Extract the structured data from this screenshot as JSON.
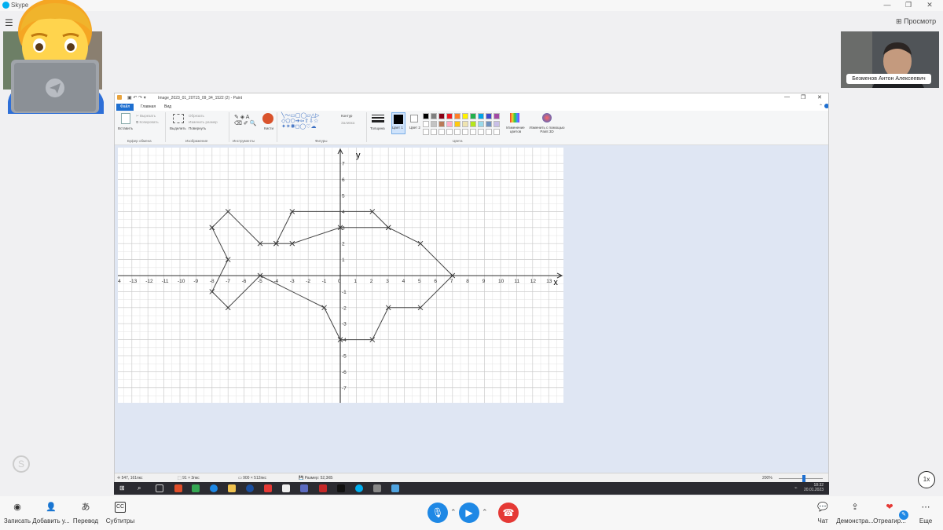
{
  "skype": {
    "app_title": "Skype",
    "preview_label": "Просмотр",
    "remote_participant_name": "Безменов Антон Алексеевич",
    "speed_label": "1x",
    "bottom_left": [
      {
        "label": "Записать",
        "icon": "record-icon"
      },
      {
        "label": "Добавить у...",
        "icon": "add-person-icon"
      },
      {
        "label": "Перевод",
        "icon": "translate-icon"
      },
      {
        "label": "Субтитры",
        "icon": "subtitles-icon"
      }
    ],
    "bottom_right": [
      {
        "label": "Чат",
        "icon": "chat-icon"
      },
      {
        "label": "Демонстра...",
        "icon": "share-screen-icon"
      },
      {
        "label": "Отреагир...",
        "icon": "react-heart-icon"
      },
      {
        "label": "Еще",
        "icon": "more-icon"
      }
    ],
    "colors": {
      "accent": "#1e88e5",
      "hangup": "#e53935"
    }
  },
  "paint": {
    "title": "Image_2023_01_20T15_09_34_1522 (2) - Paint",
    "tabs": [
      "Файл",
      "Главная",
      "Вид"
    ],
    "ribbon": {
      "paste": "Вставить",
      "cut": "Вырезать",
      "copy": "Копировать",
      "clipboard_group": "Буфер обмена",
      "select": "Выделить",
      "crop": "Обрезать",
      "resize": "Изменить размер",
      "rotate": "Повернуть",
      "image_group": "Изображение",
      "tools_group": "Инструменты",
      "brushes": "Кисти",
      "shapes_group": "Фигуры",
      "outline": "Контур",
      "fill": "Заливка",
      "thickness": "Толщина",
      "color1": "Цвет 1",
      "color2": "Цвет 2",
      "colors_group": "Цвета",
      "edit_colors": "Изменение цветов",
      "paint3d": "Изменить с помощью Paint 3D"
    },
    "palette": [
      "#000000",
      "#7f7f7f",
      "#880015",
      "#ed1c24",
      "#ff7f27",
      "#fff200",
      "#22b14c",
      "#00a2e8",
      "#3f48cc",
      "#a349a4",
      "#ffffff",
      "#c3c3c3",
      "#b97a57",
      "#ffaec9",
      "#ffc90e",
      "#efe4b0",
      "#b5e61d",
      "#99d9ea",
      "#7092be",
      "#c8bfe7"
    ],
    "status": {
      "cursor": "547, 161пкс",
      "selection": "91 × 3пкс",
      "canvas_size": "900 × 512пкс",
      "file_size": "Размер: 52,3КБ",
      "zoom": "200%"
    }
  },
  "taskbar": {
    "time": "18:32",
    "date": "20.01.2023"
  },
  "chart_data": {
    "type": "scatter",
    "xlabel": "x",
    "ylabel": "y",
    "xlim": [
      -14,
      13
    ],
    "ylim": [
      -7,
      7
    ],
    "x_ticks": [
      -14,
      -13,
      -12,
      -11,
      -10,
      -9,
      -8,
      -7,
      -6,
      -5,
      -4,
      -3,
      -2,
      -1,
      0,
      1,
      2,
      3,
      4,
      5,
      6,
      7,
      8,
      9,
      10,
      11,
      12,
      13
    ],
    "y_ticks": [
      -7,
      -6,
      -5,
      -4,
      -3,
      -2,
      -1,
      1,
      2,
      3,
      4,
      5,
      6,
      7
    ],
    "grid": true,
    "polylines": [
      {
        "points": [
          [
            -8,
            3
          ],
          [
            -7,
            4
          ],
          [
            -5,
            2
          ],
          [
            -4,
            2
          ],
          [
            -3,
            4
          ],
          [
            2,
            4
          ],
          [
            3,
            3
          ],
          [
            5,
            2
          ],
          [
            7,
            0
          ],
          [
            5,
            -2
          ],
          [
            3,
            -2
          ],
          [
            2,
            -4
          ],
          [
            0,
            -4
          ],
          [
            -1,
            -2
          ],
          [
            -5,
            0
          ],
          [
            -7,
            -2
          ],
          [
            -8,
            -1
          ],
          [
            -7,
            1
          ],
          [
            -8,
            3
          ]
        ]
      },
      {
        "points": [
          [
            -4,
            2
          ],
          [
            -3,
            2
          ],
          [
            0,
            3
          ],
          [
            3,
            3
          ]
        ]
      }
    ]
  }
}
